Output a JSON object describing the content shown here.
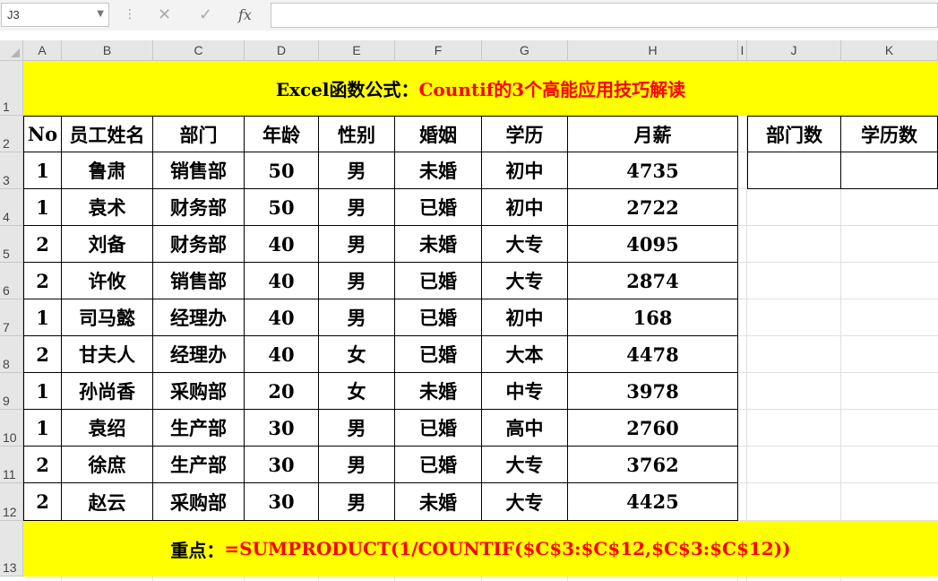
{
  "formula_bar": {
    "name_box": "J3",
    "cancel_glyph": "✕",
    "enter_glyph": "✓",
    "fx_label": "fx",
    "formula": ""
  },
  "columns": [
    "A",
    "B",
    "C",
    "D",
    "E",
    "F",
    "G",
    "H",
    "I",
    "J",
    "K"
  ],
  "rows": [
    "1",
    "2",
    "3",
    "4",
    "5",
    "6",
    "7",
    "8",
    "9",
    "10",
    "11",
    "12",
    "13"
  ],
  "title": {
    "prefix": "Excel函数公式：",
    "main": "Countif的3个高能应用技巧解读"
  },
  "table": {
    "headers": [
      "No",
      "员工姓名",
      "部门",
      "年龄",
      "性别",
      "婚姻",
      "学历",
      "月薪"
    ],
    "rows": [
      [
        "1",
        "鲁肃",
        "销售部",
        "50",
        "男",
        "未婚",
        "初中",
        "4735"
      ],
      [
        "1",
        "袁术",
        "财务部",
        "50",
        "男",
        "已婚",
        "初中",
        "2722"
      ],
      [
        "2",
        "刘备",
        "财务部",
        "40",
        "男",
        "未婚",
        "大专",
        "4095"
      ],
      [
        "2",
        "许攸",
        "销售部",
        "40",
        "男",
        "已婚",
        "大专",
        "2874"
      ],
      [
        "1",
        "司马懿",
        "经理办",
        "40",
        "男",
        "已婚",
        "初中",
        "168"
      ],
      [
        "2",
        "甘夫人",
        "经理办",
        "40",
        "女",
        "已婚",
        "大本",
        "4478"
      ],
      [
        "1",
        "孙尚香",
        "采购部",
        "20",
        "女",
        "未婚",
        "中专",
        "3978"
      ],
      [
        "1",
        "袁绍",
        "生产部",
        "30",
        "男",
        "已婚",
        "高中",
        "2760"
      ],
      [
        "2",
        "徐庶",
        "生产部",
        "30",
        "男",
        "已婚",
        "大专",
        "3762"
      ],
      [
        "2",
        "赵云",
        "采购部",
        "30",
        "男",
        "未婚",
        "大专",
        "4425"
      ]
    ]
  },
  "side_table": {
    "headers": [
      "部门数",
      "学历数"
    ],
    "values": [
      "",
      ""
    ]
  },
  "footer": {
    "label": "重点：",
    "formula": "=SUMPRODUCT(1/COUNTIF($C$3:$C$12,$C$3:$C$12))"
  },
  "colors": {
    "banner": "#ffff00",
    "accent_text": "#ff0000"
  }
}
